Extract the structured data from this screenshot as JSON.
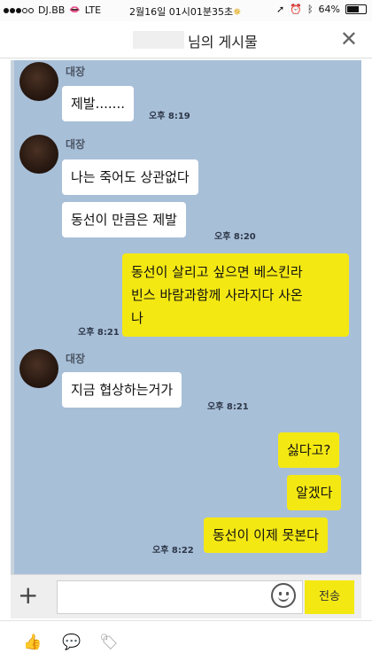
{
  "status_bar": {
    "carrier": "DJ.BB",
    "network": "LTE",
    "datetime": "2월16일 01시01분35초",
    "battery": "64%",
    "battery_level": 0.64
  },
  "header": {
    "title": "님의 게시물",
    "close_icon": "close-icon"
  },
  "chat": {
    "messages": [
      {
        "sender": "대장",
        "text": "제발.......",
        "time": "오후 8:19"
      },
      {
        "sender": "대장",
        "text": "나는 죽어도 상관없다"
      },
      {
        "text": "동선이 만큼은  제발",
        "time": "오후 8:20"
      },
      {
        "text_line1": "동선이 살리고 싶으면 베스킨라",
        "text_line2": "빈스 바람과함께 사라지다 사온",
        "text_line3": "나",
        "time": "오후 8:21"
      },
      {
        "sender": "대장",
        "text": "지금 협상하는거가",
        "time": "오후 8:21"
      },
      {
        "text": "싫다고?"
      },
      {
        "text": "알겠다"
      },
      {
        "text": "동선이 이제 못본다",
        "time": "오후 8:22"
      }
    ]
  },
  "input_bar": {
    "plus_label": "+",
    "send_label": "전송"
  },
  "icons": {
    "like": "thumbs-up-icon",
    "comment": "comment-icon",
    "tag": "tag-icon"
  },
  "colors": {
    "chat_background": "#a8bfd8",
    "my_bubble": "#f4e813",
    "other_bubble": "#ffffff"
  }
}
